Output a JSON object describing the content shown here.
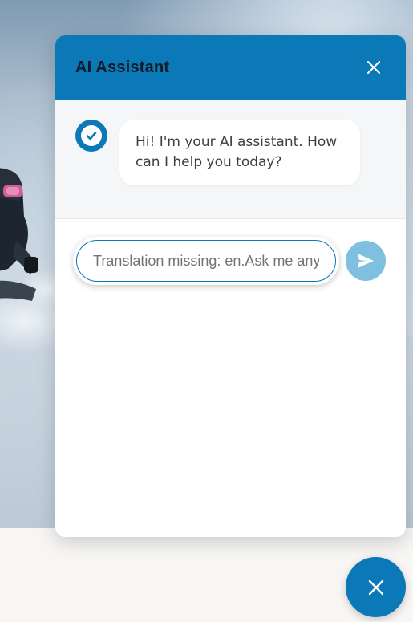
{
  "chat": {
    "title": "AI Assistant",
    "messages": [
      {
        "sender": "bot",
        "text": "Hi! I'm your AI assistant. How can I help you today?"
      }
    ],
    "input": {
      "value": "",
      "placeholder": "Translation missing: en.Ask me anything"
    },
    "icons": {
      "close": "close-icon",
      "avatar": "check-circle-icon",
      "send": "send-icon",
      "launcher": "close-icon"
    }
  },
  "colors": {
    "brand": "#0b78b8",
    "send_disabled": "#7fbfe0",
    "messages_bg": "#f4f6f8",
    "page_bg": "#f7f6f4"
  }
}
